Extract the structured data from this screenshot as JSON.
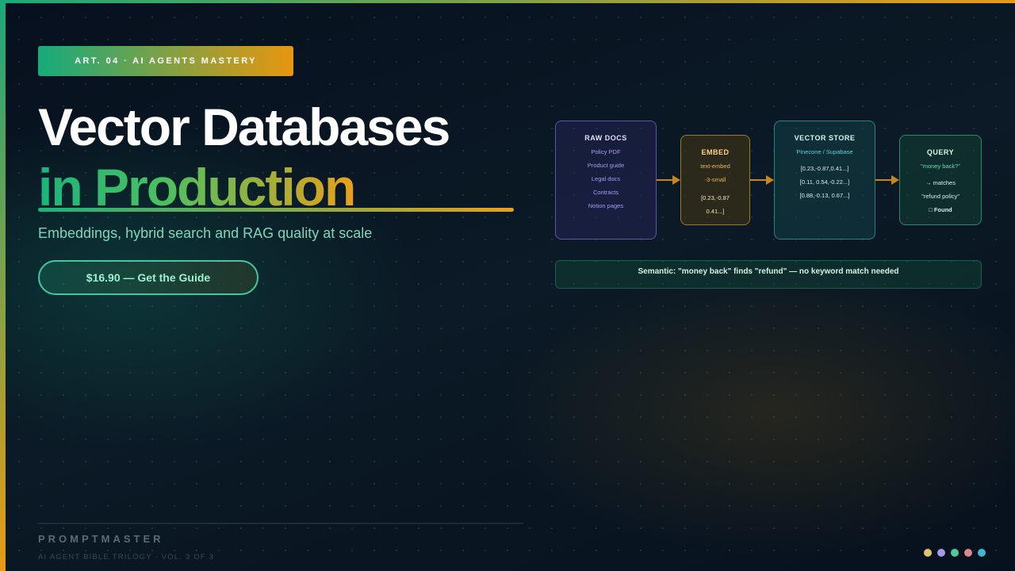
{
  "badge": "ART. 04 · AI AGENTS MASTERY",
  "title_line1": "Vector Databases",
  "title_line2": "in Production",
  "subtitle": "Embeddings, hybrid search and RAG quality at scale",
  "cta_label": "$16.90 — Get the Guide",
  "diagram": {
    "raw_docs": {
      "title": "RAW DOCS",
      "items": [
        "Policy PDF",
        "Product guide",
        "Legal docs",
        "Contracts",
        "Notion pages"
      ]
    },
    "embed": {
      "title": "EMBED",
      "model_line1": "text-embed",
      "model_line2": "-3-small",
      "vector_line1": "[0.23,-0.87",
      "vector_line2": "0.41...]"
    },
    "vector_store": {
      "title": "VECTOR STORE",
      "provider": "Pinecone / Supabase",
      "vectors": [
        "[0.23,-0.87,0.41...]",
        "[0.11, 0.54,-0.22...]",
        "[0.88,-0.13, 0.67...]"
      ]
    },
    "query": {
      "title": "QUERY",
      "text": "\"money back?\"",
      "matches": "→ matches",
      "result": "\"refund policy\"",
      "found": "□ Found"
    },
    "semantic_note": "Semantic: \"money back\" finds \"refund\" — no keyword match needed"
  },
  "footer": {
    "brand": "PROMPTMASTER",
    "volume": "AI AGENT BIBLE TRILOGY · VOL. 3 OF 3"
  },
  "dot_colors": [
    "#e2c46a",
    "#a89be6",
    "#4fc99a",
    "#d98a8a",
    "#3fb8d0"
  ],
  "colors": {
    "accent_green": "#1aa87a",
    "accent_orange": "#e89a12",
    "background": "#0a1220"
  }
}
